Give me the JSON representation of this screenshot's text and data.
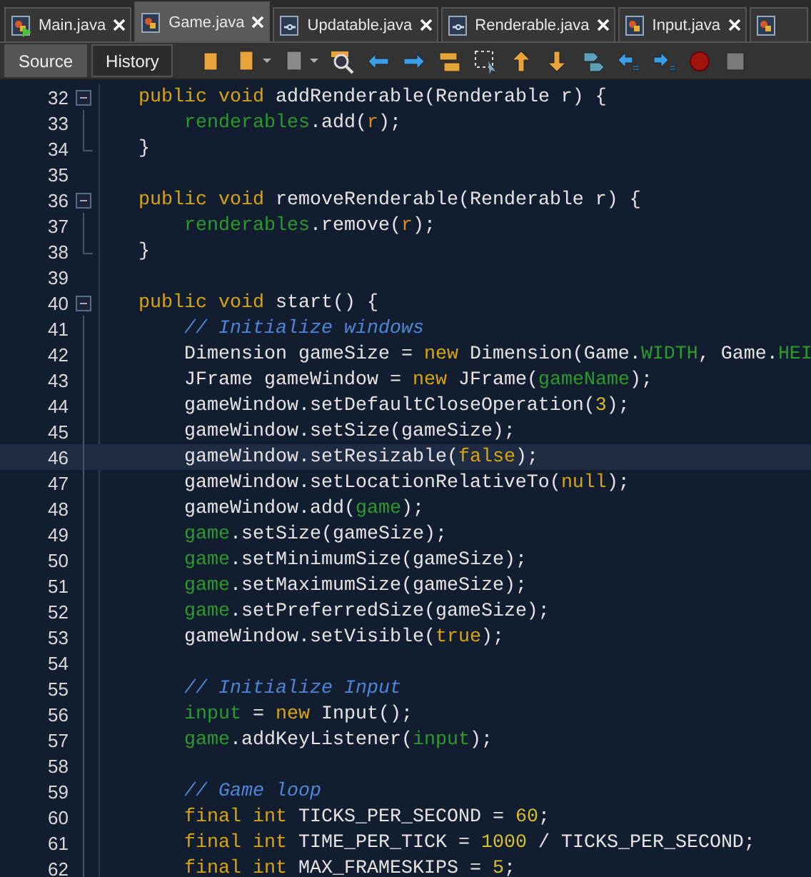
{
  "tabs": [
    {
      "label": "Main.java",
      "selected": false,
      "kind": "runnable"
    },
    {
      "label": "Game.java",
      "selected": true,
      "kind": "class"
    },
    {
      "label": "Updatable.java",
      "selected": false,
      "kind": "interface"
    },
    {
      "label": "Renderable.java",
      "selected": false,
      "kind": "interface"
    },
    {
      "label": "Input.java",
      "selected": false,
      "kind": "class"
    }
  ],
  "view_buttons": [
    {
      "label": "Source",
      "selected": true
    },
    {
      "label": "History",
      "selected": false
    }
  ],
  "code_lines": [
    {
      "number": "32",
      "kind": "fold-start",
      "current": false,
      "tokens": [
        {
          "kind": "keyword",
          "text": "    public void"
        },
        {
          "kind": "plain",
          "text": " addRenderable(Renderable r) {"
        }
      ]
    },
    {
      "number": "33",
      "kind": "fold-body",
      "current": false,
      "tokens": [
        {
          "kind": "field",
          "text": "        renderables"
        },
        {
          "kind": "plain",
          "text": ".add("
        },
        {
          "kind": "param",
          "text": "r"
        },
        {
          "kind": "plain",
          "text": ");"
        }
      ]
    },
    {
      "number": "34",
      "kind": "fold-end",
      "current": false,
      "tokens": [
        {
          "kind": "plain",
          "text": "    }"
        }
      ]
    },
    {
      "number": "35",
      "kind": "plain",
      "current": false
    },
    {
      "number": "36",
      "kind": "fold-start",
      "current": false,
      "tokens": [
        {
          "kind": "keyword",
          "text": "    public void"
        },
        {
          "kind": "plain",
          "text": " removeRenderable(Renderable r) {"
        }
      ]
    },
    {
      "number": "37",
      "kind": "fold-body",
      "current": false,
      "tokens": [
        {
          "kind": "field",
          "text": "        renderables"
        },
        {
          "kind": "plain",
          "text": ".remove("
        },
        {
          "kind": "param",
          "text": "r"
        },
        {
          "kind": "plain",
          "text": ");"
        }
      ]
    },
    {
      "number": "38",
      "kind": "fold-end",
      "current": false,
      "tokens": [
        {
          "kind": "plain",
          "text": "    }"
        }
      ]
    },
    {
      "number": "39",
      "kind": "plain",
      "current": false
    },
    {
      "number": "40",
      "kind": "fold-start",
      "current": false,
      "tokens": [
        {
          "kind": "keyword",
          "text": "    public void"
        },
        {
          "kind": "plain",
          "text": " start() {"
        }
      ]
    },
    {
      "number": "41",
      "kind": "fold-body",
      "current": false,
      "tokens": [
        {
          "kind": "comment",
          "text": "        // Initialize windows"
        }
      ]
    },
    {
      "number": "42",
      "kind": "fold-body",
      "current": false,
      "tokens": [
        {
          "kind": "plain",
          "text": "        Dimension gameSize = "
        },
        {
          "kind": "keyword",
          "text": "new"
        },
        {
          "kind": "plain",
          "text": " Dimension(Game."
        },
        {
          "kind": "field",
          "text": "WIDTH"
        },
        {
          "kind": "plain",
          "text": ", Game."
        },
        {
          "kind": "field",
          "text": "HEI"
        }
      ]
    },
    {
      "number": "43",
      "kind": "fold-body",
      "current": false,
      "tokens": [
        {
          "kind": "plain",
          "text": "        JFrame gameWindow = "
        },
        {
          "kind": "keyword",
          "text": "new"
        },
        {
          "kind": "plain",
          "text": " JFrame("
        },
        {
          "kind": "field",
          "text": "gameName"
        },
        {
          "kind": "plain",
          "text": ");"
        }
      ]
    },
    {
      "number": "44",
      "kind": "fold-body",
      "current": false,
      "tokens": [
        {
          "kind": "plain",
          "text": "        gameWindow.setDefaultCloseOperation("
        },
        {
          "kind": "number",
          "text": "3"
        },
        {
          "kind": "plain",
          "text": ");"
        }
      ]
    },
    {
      "number": "45",
      "kind": "fold-body",
      "current": false,
      "tokens": [
        {
          "kind": "plain",
          "text": "        gameWindow.setSize(gameSize);"
        }
      ]
    },
    {
      "number": "46",
      "kind": "fold-body",
      "current": true,
      "tokens": [
        {
          "kind": "plain",
          "text": "        gameWindow.setResizable("
        },
        {
          "kind": "keyword",
          "text": "false"
        },
        {
          "kind": "plain",
          "text": ");"
        }
      ]
    },
    {
      "number": "47",
      "kind": "fold-body",
      "current": false,
      "tokens": [
        {
          "kind": "plain",
          "text": "        gameWindow.setLocationRelativeTo("
        },
        {
          "kind": "keyword",
          "text": "null"
        },
        {
          "kind": "plain",
          "text": ");"
        }
      ]
    },
    {
      "number": "48",
      "kind": "fold-body",
      "current": false,
      "tokens": [
        {
          "kind": "plain",
          "text": "        gameWindow.add("
        },
        {
          "kind": "field",
          "text": "game"
        },
        {
          "kind": "plain",
          "text": ");"
        }
      ]
    },
    {
      "number": "49",
      "kind": "fold-body",
      "current": false,
      "tokens": [
        {
          "kind": "field",
          "text": "        game"
        },
        {
          "kind": "plain",
          "text": ".setSize(gameSize);"
        }
      ]
    },
    {
      "number": "50",
      "kind": "fold-body",
      "current": false,
      "tokens": [
        {
          "kind": "field",
          "text": "        game"
        },
        {
          "kind": "plain",
          "text": ".setMinimumSize(gameSize);"
        }
      ]
    },
    {
      "number": "51",
      "kind": "fold-body",
      "current": false,
      "tokens": [
        {
          "kind": "field",
          "text": "        game"
        },
        {
          "kind": "plain",
          "text": ".setMaximumSize(gameSize);"
        }
      ]
    },
    {
      "number": "52",
      "kind": "fold-body",
      "current": false,
      "tokens": [
        {
          "kind": "field",
          "text": "        game"
        },
        {
          "kind": "plain",
          "text": ".setPreferredSize(gameSize);"
        }
      ]
    },
    {
      "number": "53",
      "kind": "fold-body",
      "current": false,
      "tokens": [
        {
          "kind": "plain",
          "text": "        gameWindow.setVisible("
        },
        {
          "kind": "keyword",
          "text": "true"
        },
        {
          "kind": "plain",
          "text": ");"
        }
      ]
    },
    {
      "number": "54",
      "kind": "fold-body",
      "current": false
    },
    {
      "number": "55",
      "kind": "fold-body",
      "current": false,
      "tokens": [
        {
          "kind": "comment",
          "text": "        // Initialize Input"
        }
      ]
    },
    {
      "number": "56",
      "kind": "fold-body",
      "current": false,
      "tokens": [
        {
          "kind": "field",
          "text": "        input"
        },
        {
          "kind": "plain",
          "text": " = "
        },
        {
          "kind": "keyword",
          "text": "new"
        },
        {
          "kind": "plain",
          "text": " Input();"
        }
      ]
    },
    {
      "number": "57",
      "kind": "fold-body",
      "current": false,
      "tokens": [
        {
          "kind": "field",
          "text": "        game"
        },
        {
          "kind": "plain",
          "text": ".addKeyListener("
        },
        {
          "kind": "field",
          "text": "input"
        },
        {
          "kind": "plain",
          "text": ");"
        }
      ]
    },
    {
      "number": "58",
      "kind": "fold-body",
      "current": false
    },
    {
      "number": "59",
      "kind": "fold-body",
      "current": false,
      "tokens": [
        {
          "kind": "comment",
          "text": "        // Game loop"
        }
      ]
    },
    {
      "number": "60",
      "kind": "fold-body",
      "current": false,
      "tokens": [
        {
          "kind": "keyword",
          "text": "        final int"
        },
        {
          "kind": "plain",
          "text": " TICKS_PER_SECOND = "
        },
        {
          "kind": "number",
          "text": "60"
        },
        {
          "kind": "plain",
          "text": ";"
        }
      ]
    },
    {
      "number": "61",
      "kind": "fold-body",
      "current": false,
      "tokens": [
        {
          "kind": "keyword",
          "text": "        final int"
        },
        {
          "kind": "plain",
          "text": " TIME_PER_TICK = "
        },
        {
          "kind": "number",
          "text": "1000"
        },
        {
          "kind": "plain",
          "text": " / TICKS_PER_SECOND;"
        }
      ]
    },
    {
      "number": "62",
      "kind": "fold-body",
      "current": false,
      "tokens": [
        {
          "kind": "keyword",
          "text": "        final int"
        },
        {
          "kind": "plain",
          "text": " MAX_FRAMESKIPS = "
        },
        {
          "kind": "number",
          "text": "5"
        },
        {
          "kind": "plain",
          "text": ";"
        }
      ]
    }
  ]
}
